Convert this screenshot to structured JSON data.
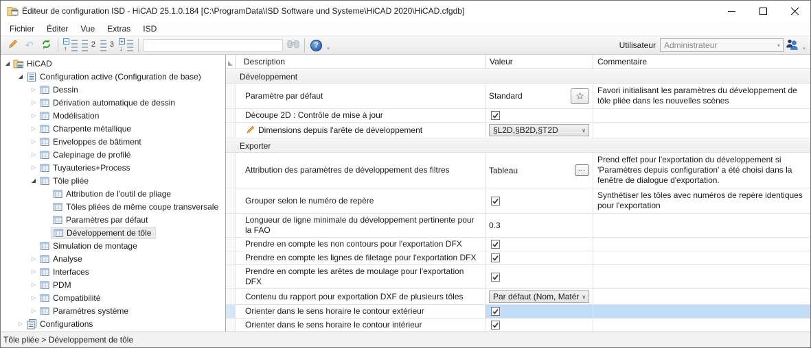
{
  "window": {
    "title": "Éditeur de configuration ISD  - HiCAD 25.1.0.184 [C:\\ProgramData\\ISD Software und Systeme\\HiCAD 2020\\HiCAD.cfgdb]"
  },
  "menubar": {
    "items": [
      "Fichier",
      "Éditer",
      "Vue",
      "Extras",
      "ISD"
    ]
  },
  "toolbar": {
    "icons": [
      "pencil-icon",
      "undo-icon",
      "refresh-icon",
      "tree-collapse-icon",
      "tree-level-2-icon",
      "tree-level-3-icon",
      "tree-expand-icon",
      "binoculars-icon",
      "help-icon",
      "users-icon"
    ],
    "user_label": "Utilisateur",
    "user_value": "Administrateur"
  },
  "tree": {
    "items": [
      {
        "label": "HiCAD",
        "level": 0,
        "expander": "expanded",
        "icon": "folder-table-icon"
      },
      {
        "label": "Configuration active (Configuration de base)",
        "level": 1,
        "expander": "expanded",
        "icon": "list-icon"
      },
      {
        "label": "Dessin",
        "level": 2,
        "expander": "collapsed",
        "icon": "table-icon"
      },
      {
        "label": "Dérivation automatique de dessin",
        "level": 2,
        "expander": "collapsed",
        "icon": "table-icon"
      },
      {
        "label": "Modélisation",
        "level": 2,
        "expander": "collapsed",
        "icon": "table-icon"
      },
      {
        "label": "Charpente métallique",
        "level": 2,
        "expander": "collapsed",
        "icon": "table-icon"
      },
      {
        "label": "Enveloppes de bâtiment",
        "level": 2,
        "expander": "collapsed",
        "icon": "table-icon"
      },
      {
        "label": "Calepinage de profilé",
        "level": 2,
        "expander": "collapsed",
        "icon": "table-icon"
      },
      {
        "label": "Tuyauteries+Process",
        "level": 2,
        "expander": "collapsed",
        "icon": "table-icon"
      },
      {
        "label": "Tôle pliée",
        "level": 2,
        "expander": "expanded",
        "icon": "table-icon"
      },
      {
        "label": "Attribution de l'outil de pliage",
        "level": 3,
        "expander": "none",
        "icon": "table-icon"
      },
      {
        "label": "Tôles pliées de même coupe transversale",
        "level": 3,
        "expander": "none",
        "icon": "table-icon"
      },
      {
        "label": "Paramètres par défaut",
        "level": 3,
        "expander": "none",
        "icon": "table-icon"
      },
      {
        "label": "Développement de tôle",
        "level": 3,
        "expander": "none",
        "icon": "table-icon",
        "selected": true
      },
      {
        "label": "Simulation de montage",
        "level": 2,
        "expander": "none",
        "icon": "table-icon"
      },
      {
        "label": "Analyse",
        "level": 2,
        "expander": "collapsed",
        "icon": "table-icon"
      },
      {
        "label": "Interfaces",
        "level": 2,
        "expander": "collapsed",
        "icon": "table-icon"
      },
      {
        "label": "PDM",
        "level": 2,
        "expander": "collapsed",
        "icon": "table-icon"
      },
      {
        "label": "Compatibilité",
        "level": 2,
        "expander": "collapsed",
        "icon": "table-icon"
      },
      {
        "label": "Paramètres système",
        "level": 2,
        "expander": "collapsed",
        "icon": "table-icon"
      },
      {
        "label": "Configurations",
        "level": 1,
        "expander": "collapsed",
        "icon": "stack-icon"
      }
    ]
  },
  "grid": {
    "columns": [
      "Description",
      "Valeur",
      "Commentaire"
    ],
    "rows": [
      {
        "type": "section",
        "label": "Développement"
      },
      {
        "type": "item",
        "description": "Paramètre par défaut",
        "value": "Standard",
        "control": "favorite",
        "comment": "Favori initialisant les paramètres du développement de tôle pliée dans les nouvelles scènes"
      },
      {
        "type": "item",
        "description": "Découpe 2D : Contrôle de mise à jour",
        "control": "checkbox",
        "checked": true,
        "comment": ""
      },
      {
        "type": "item",
        "description": "Dimensions depuis l'arête de développement",
        "desc_icon": "pencil-icon",
        "control": "select",
        "value": "§L2D,§B2D,§T2D",
        "comment": ""
      },
      {
        "type": "section",
        "label": "Exporter"
      },
      {
        "type": "item",
        "description": "Attribution des paramètres de développement des filtres",
        "value": "Tableau",
        "control": "ellipsis",
        "comment": "Prend effet pour l'exportation du développement si 'Paramètres depuis configuration' a été choisi dans la fenêtre de dialogue d'exportation."
      },
      {
        "type": "item",
        "description": "Grouper selon le numéro de repère",
        "control": "checkbox",
        "checked": true,
        "comment": "Synthétiser les tôles avec numéros de repère identiques pour l'exportation"
      },
      {
        "type": "item",
        "description": "Longueur de ligne minimale du développement pertinente pour la FAO",
        "value": "0.3",
        "control": "text",
        "comment": ""
      },
      {
        "type": "item",
        "description": "Prendre en compte les non contours pour l'exportation DFX",
        "control": "checkbox",
        "checked": true,
        "comment": ""
      },
      {
        "type": "item",
        "description": "Prendre en compte les lignes de filetage pour l'exportation DFX",
        "control": "checkbox",
        "checked": true,
        "comment": ""
      },
      {
        "type": "item",
        "description": "Prendre en compte les arêtes de moulage pour l'exportation DFX",
        "control": "checkbox",
        "checked": true,
        "comment": ""
      },
      {
        "type": "item",
        "description": "Contenu du rapport pour exportation DXF de plusieurs tôles",
        "control": "select",
        "value": "Par défaut (Nom, Matér",
        "comment": ""
      },
      {
        "type": "item",
        "description": "Orienter dans le sens horaire le contour extérieur",
        "control": "checkbox",
        "checked": true,
        "selected": true,
        "comment": ""
      },
      {
        "type": "item",
        "description": "Orienter dans le sens horaire le contour intérieur",
        "control": "checkbox",
        "checked": true,
        "comment": ""
      }
    ]
  },
  "statusbar": {
    "text": "Tôle pliée > Développement de tôle"
  },
  "colors": {
    "selection_blue": "#c2dcf5",
    "tree_selection_gray": "#ececec",
    "section_gray": "#f1f1f1",
    "refresh_green": "#2ca02c",
    "pencil_orange": "#f0a93e",
    "help_blue": "#1d4fa0"
  }
}
